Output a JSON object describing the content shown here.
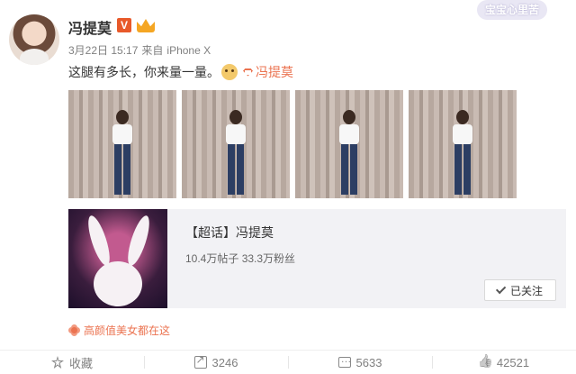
{
  "watermark": "宝宝心里苦",
  "author": {
    "name": "冯提莫",
    "verified_badge": "V"
  },
  "meta": {
    "time": "3月22日 15:17",
    "source_prefix": "来自",
    "device": "iPhone X"
  },
  "post": {
    "text": "这腿有多长，你来量一量。",
    "topic_link": "冯提莫"
  },
  "photos": [
    "photo-1",
    "photo-2",
    "photo-3",
    "photo-4"
  ],
  "card": {
    "title": "【超话】冯提莫",
    "stats": "10.4万帖子 33.3万粉丝",
    "follow_label": "已关注"
  },
  "source_label": "高颜值美女都在这",
  "actions": {
    "favorite": "收藏",
    "repost": "3246",
    "comment": "5633",
    "like": "42521"
  },
  "colors": {
    "accent": "#eb7350",
    "badge": "#e8592a"
  },
  "icons": {
    "favorite": "star-icon",
    "repost": "share-icon",
    "comment": "comment-icon",
    "like": "thumbs-up-icon"
  }
}
